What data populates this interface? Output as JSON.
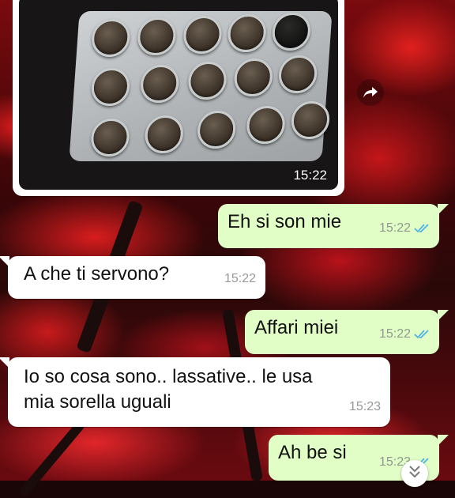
{
  "chat": {
    "image_message": {
      "time": "15:22",
      "icon": "blister-pack-photo"
    },
    "forward_icon": "share-arrow-icon",
    "messages": [
      {
        "direction": "out",
        "text": "Eh si son mie",
        "time": "15:22",
        "status": "read"
      },
      {
        "direction": "in",
        "text": "A che ti servono?",
        "time": "15:22"
      },
      {
        "direction": "out",
        "text": "Affari miei",
        "time": "15:22",
        "status": "read"
      },
      {
        "direction": "in",
        "text_line1": "Io so cosa sono.. lassative.. le usa",
        "text_line2": "mia sorella uguali",
        "time": "15:23"
      },
      {
        "direction": "out",
        "text": "Ah be si",
        "time": "15:23",
        "status": "read"
      }
    ],
    "scroll_down_icon": "chevron-double-down-icon"
  },
  "colors": {
    "outgoing_bubble": "#e1fec6",
    "incoming_bubble": "#ffffff",
    "read_ticks": "#4fb3e8"
  }
}
